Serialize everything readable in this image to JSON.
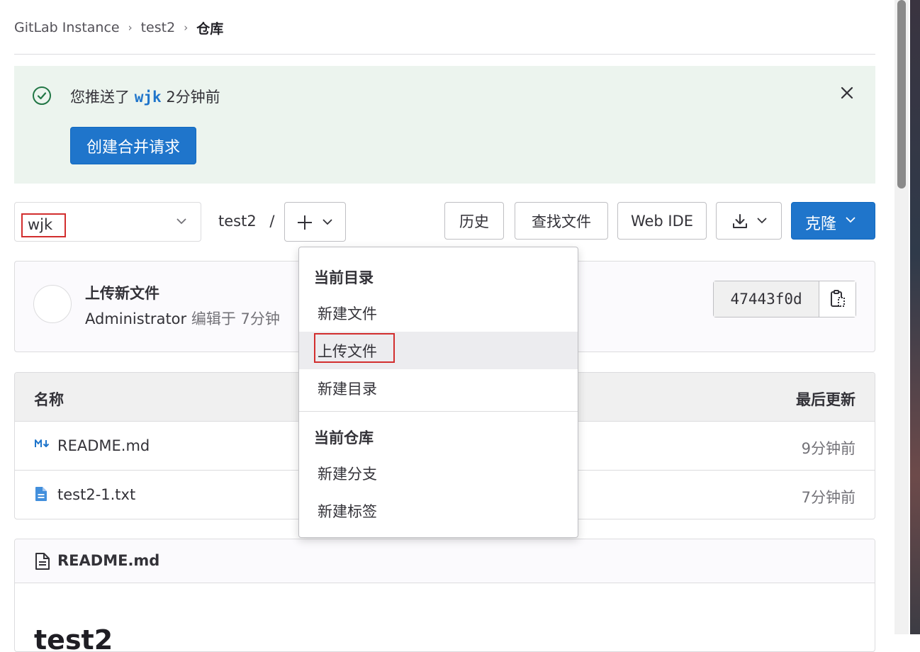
{
  "breadcrumb": {
    "items": [
      "GitLab Instance",
      "test2"
    ],
    "current": "仓库"
  },
  "alert": {
    "prefix": "您推送了",
    "branch": "wjk",
    "suffix": "2分钟前",
    "button_label": "创建合并请求"
  },
  "toolbar": {
    "branch": "wjk",
    "path": "test2",
    "path_sep": "/",
    "history_label": "历史",
    "find_file_label": "查找文件",
    "web_ide_label": "Web IDE",
    "clone_label": "克隆"
  },
  "commit": {
    "title": "上传新文件",
    "author": "Administrator",
    "meta_text": "编辑于 7分钟",
    "sha": "47443f0d"
  },
  "files": {
    "col_name": "名称",
    "col_updated": "最后更新",
    "rows": [
      {
        "name": "README.md",
        "time": "9分钟前",
        "icon": "markdown-icon"
      },
      {
        "name": "test2-1.txt",
        "time": "7分钟前",
        "icon": "file-icon"
      }
    ]
  },
  "readme": {
    "title": "README.md",
    "heading": "test2"
  },
  "dropdown": {
    "section1": "当前目录",
    "items1": [
      "新建文件",
      "上传文件",
      "新建目录"
    ],
    "section2": "当前仓库",
    "items2": [
      "新建分支",
      "新建标签"
    ]
  },
  "colors": {
    "primary": "#1f75cb",
    "alert_bg": "#ecf4ee",
    "success": "#217645",
    "highlight_box": "#d22e2e"
  }
}
